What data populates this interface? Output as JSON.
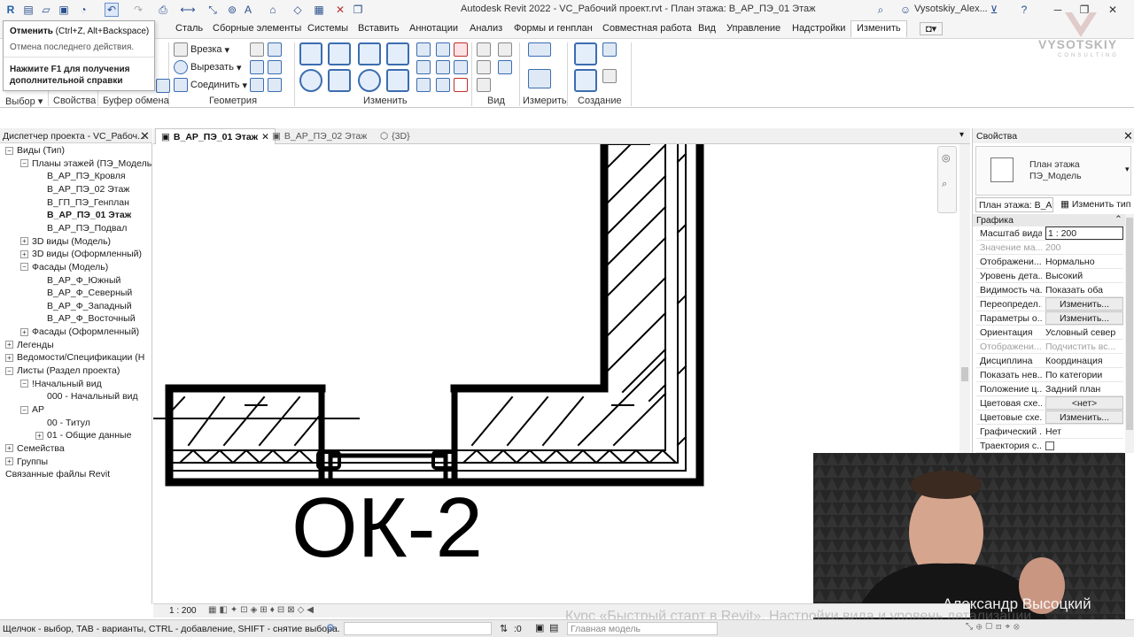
{
  "title_bar": {
    "app_title": "Autodesk Revit 2022 - VC_Рабочий проект.rvt - План этажа: В_АР_ПЭ_01 Этаж",
    "user": "Vysotskiy_Alex..."
  },
  "tooltip": {
    "command": "Отменить",
    "shortcut": "(Ctrl+Z, Alt+Backspace)",
    "description": "Отмена последнего действия.",
    "help": "Нажмите F1 для получения дополнительной справки"
  },
  "ribbon_tabs": [
    "Сталь",
    "Сборные элементы",
    "Системы",
    "Вставить",
    "Аннотации",
    "Анализ",
    "Формы и генплан",
    "Совместная работа",
    "Вид",
    "Управление",
    "Надстройки",
    "Изменить"
  ],
  "ribbon": {
    "geometry": {
      "cut": "Врезка",
      "cut_out": "Вырезать",
      "join": "Соединить"
    },
    "panels": {
      "select": "Выбор",
      "properties": "Свойства",
      "clipboard": "Буфер обмена",
      "geometry": "Геометрия",
      "modify": "Изменить",
      "view": "Вид",
      "measure": "Измерить",
      "create": "Создание"
    }
  },
  "logo": {
    "word": "VYSOTSKIY",
    "sub": "CONSULTING"
  },
  "browser": {
    "header": "Диспетчер проекта - VC_Рабоч...",
    "items": [
      {
        "label": "Виды (Тип)",
        "level": 0,
        "toggle": "-"
      },
      {
        "label": "Планы этажей (ПЭ_Модель",
        "level": 1,
        "toggle": "-"
      },
      {
        "label": "В_АР_ПЭ_Кровля",
        "level": 2,
        "toggle": ""
      },
      {
        "label": "В_АР_ПЭ_02 Этаж",
        "level": 2,
        "toggle": ""
      },
      {
        "label": "В_ГП_ПЭ_Генплан",
        "level": 2,
        "toggle": ""
      },
      {
        "label": "В_АР_ПЭ_01 Этаж",
        "level": 2,
        "toggle": "",
        "bold": true
      },
      {
        "label": "В_АР_ПЭ_Подвал",
        "level": 2,
        "toggle": ""
      },
      {
        "label": "3D виды (Модель)",
        "level": 1,
        "toggle": "+"
      },
      {
        "label": "3D виды (Оформленный)",
        "level": 1,
        "toggle": "+"
      },
      {
        "label": "Фасады (Модель)",
        "level": 1,
        "toggle": "-"
      },
      {
        "label": "В_АР_Ф_Южный",
        "level": 2,
        "toggle": ""
      },
      {
        "label": "В_АР_Ф_Северный",
        "level": 2,
        "toggle": ""
      },
      {
        "label": "В_АР_Ф_Западный",
        "level": 2,
        "toggle": ""
      },
      {
        "label": "В_АР_Ф_Восточный",
        "level": 2,
        "toggle": ""
      },
      {
        "label": "Фасады (Оформленный)",
        "level": 1,
        "toggle": "+"
      },
      {
        "label": "Легенды",
        "level": 0,
        "toggle": "+"
      },
      {
        "label": "Ведомости/Спецификации (Н",
        "level": 0,
        "toggle": "+"
      },
      {
        "label": "Листы (Раздел проекта)",
        "level": 0,
        "toggle": "-"
      },
      {
        "label": "!Начальный вид",
        "level": 1,
        "toggle": "-"
      },
      {
        "label": "000 - Начальный вид",
        "level": 2,
        "toggle": ""
      },
      {
        "label": "АР",
        "level": 1,
        "toggle": "-"
      },
      {
        "label": "00 - Титул",
        "level": 2,
        "toggle": ""
      },
      {
        "label": "01 - Общие данные",
        "level": 2,
        "toggle": "+"
      },
      {
        "label": "Семейства",
        "level": 0,
        "toggle": "+"
      },
      {
        "label": "Группы",
        "level": 0,
        "toggle": "+"
      },
      {
        "label": "Связанные файлы Revit",
        "level": 0,
        "toggle": ""
      }
    ]
  },
  "doc_tabs": [
    {
      "label": "В_АР_ПЭ_01 Этаж",
      "active": true
    },
    {
      "label": "В_АР_ПЭ_02 Этаж",
      "active": false
    },
    {
      "label": "{3D}",
      "active": false
    }
  ],
  "canvas": {
    "tag": "ОК-2"
  },
  "properties": {
    "header": "Свойства",
    "type_name_1": "План этажа",
    "type_name_2": "ПЭ_Модель",
    "instance_dropdown": "План этажа: В_А",
    "edit_type": "Изменить тип",
    "group": "Графика",
    "rows": [
      {
        "key": "Масштаб вида",
        "value": "1 : 200",
        "style": "box"
      },
      {
        "key": "Значение ма...",
        "value": "200",
        "style": "dim"
      },
      {
        "key": "Отображени...",
        "value": "Нормально",
        "style": ""
      },
      {
        "key": "Уровень дета...",
        "value": "Высокий",
        "style": ""
      },
      {
        "key": "Видимость ча...",
        "value": "Показать оба",
        "style": ""
      },
      {
        "key": "Переопредел...",
        "value": "Изменить...",
        "style": "btn"
      },
      {
        "key": "Параметры о...",
        "value": "Изменить...",
        "style": "btn"
      },
      {
        "key": "Ориентация",
        "value": "Условный север",
        "style": ""
      },
      {
        "key": "Отображени...",
        "value": "Подчистить вс...",
        "style": "dim"
      },
      {
        "key": "Дисциплина",
        "value": "Координация",
        "style": ""
      },
      {
        "key": "Показать нев...",
        "value": "По категории",
        "style": ""
      },
      {
        "key": "Положение ц...",
        "value": "Задний план",
        "style": ""
      },
      {
        "key": "Цветовая схе...",
        "value": "<нет>",
        "style": "btn"
      },
      {
        "key": "Цветовые схе...",
        "value": "Изменить...",
        "style": "btn"
      },
      {
        "key": "Графический ...",
        "value": "Нет",
        "style": ""
      },
      {
        "key": "Траектория с...",
        "value": "",
        "style": "check"
      }
    ]
  },
  "view_bar": {
    "scale": "1 : 200"
  },
  "status_bar": {
    "hint": "Щелчок - выбор, TAB - варианты, CTRL - добавление, SHIFT - снятие выбора.",
    "zero": ":0",
    "model": "Главная модель"
  },
  "overlay": {
    "presenter": "Александр Высоцкий",
    "course": "Курс «Быстрый старт в Revit». Настройки вида и уровень детализации"
  }
}
